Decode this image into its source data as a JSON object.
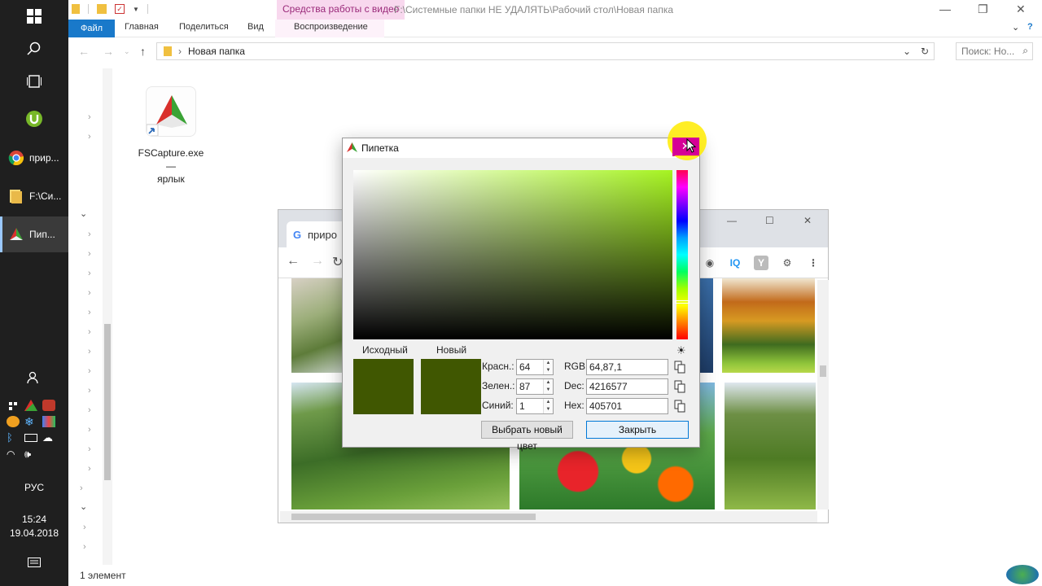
{
  "taskbar": {
    "apps": [
      {
        "label": "прир...",
        "icon": "chrome-icon"
      },
      {
        "label": "F:\\Си...",
        "icon": "folder-icon"
      },
      {
        "label": "Пип...",
        "icon": "fscapture-icon"
      }
    ],
    "language": "РУС",
    "time": "15:24",
    "date": "19.04.2018"
  },
  "explorer": {
    "context_tab": "Средства работы с видео",
    "window_title": "F:\\Системные папки НЕ УДАЛЯТЬ\\Рабочий стол\\Новая папка",
    "ribbon_tabs": {
      "file": "Файл",
      "home": "Главная",
      "share": "Поделиться",
      "view": "Вид",
      "playback": "Воспроизведение"
    },
    "address": "Новая папка",
    "search_placeholder": "Поиск: Но...",
    "file": {
      "name": "FSCapture.exe —\nярлык"
    },
    "status": "1 элемент"
  },
  "chrome": {
    "tab_title": "приро"
  },
  "dialog": {
    "title": "Пипетка",
    "original_label": "Исходный",
    "new_label": "Новый",
    "red_label": "Красн.:",
    "green_label": "Зелен.:",
    "blue_label": "Синий:",
    "red": "64",
    "green": "87",
    "blue": "1",
    "rgb_label": "RGB:",
    "dec_label": "Dec:",
    "hex_label": "Hex:",
    "rgb": "64,87,1",
    "dec": "4216577",
    "hex": "405701",
    "pick_button": "Выбрать новый цвет",
    "close_button": "Закрыть",
    "colors": {
      "swatch": "#405701",
      "close_accent": "#d60096"
    }
  }
}
